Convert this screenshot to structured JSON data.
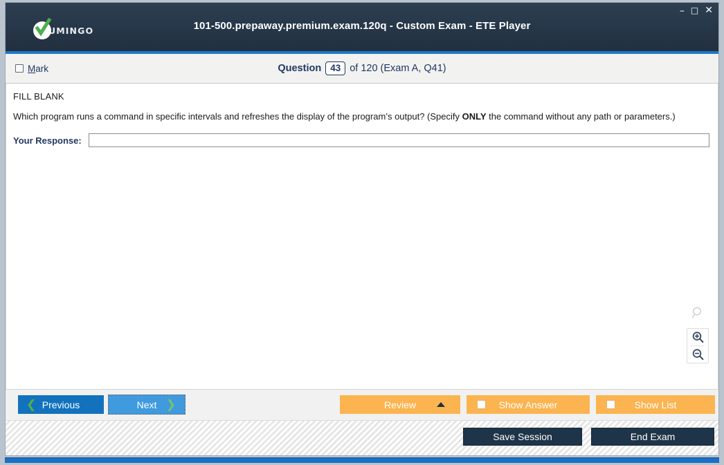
{
  "window": {
    "title": "101-500.prepaway.premium.exam.120q - Custom Exam - ETE Player",
    "logo_text": "UMINGO",
    "controls": {
      "minimize": "–",
      "maximize": "□",
      "close": "✕"
    },
    "colors": {
      "titlebar_dark": "#27384a",
      "accent_blue": "#1c78c8",
      "orange": "#fbb450",
      "dark_navy": "#1e3448",
      "green_check": "#4caf50"
    }
  },
  "qheader": {
    "mark_label_accel": "M",
    "mark_label_rest": "ark",
    "question_word": "Question",
    "question_number": "43",
    "of_text": "of 120 (Exam A, Q41)"
  },
  "content": {
    "type_label": "FILL BLANK",
    "question_part1": "Which program runs a command in specific intervals and refreshes the display of the program’s output? (Specify ",
    "question_emphasis": "ONLY",
    "question_part2": " the command without any path or parameters.)",
    "response_label": "Your Response:",
    "response_value": "",
    "response_placeholder": ""
  },
  "zoom_tools": {
    "search_icon_name": "magnifier-icon",
    "zoom_in_icon_name": "zoom-in-icon",
    "zoom_out_icon_name": "zoom-out-icon"
  },
  "actions": {
    "previous": "Previous",
    "next": "Next",
    "review": "Review",
    "show_answer": "Show Answer",
    "show_list": "Show List"
  },
  "status": {
    "save_session": "Save Session",
    "end_exam": "End Exam"
  }
}
